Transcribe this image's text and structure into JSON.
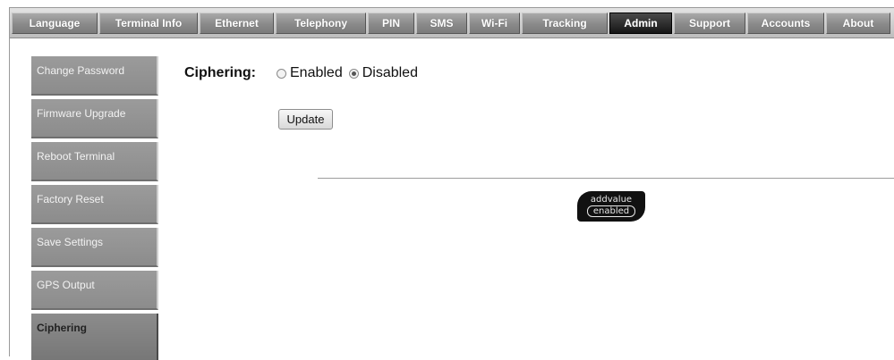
{
  "tabs": [
    {
      "label": "Language",
      "active": false
    },
    {
      "label": "Terminal Info",
      "active": false
    },
    {
      "label": "Ethernet",
      "active": false
    },
    {
      "label": "Telephony",
      "active": false
    },
    {
      "label": "PIN",
      "active": false
    },
    {
      "label": "SMS",
      "active": false
    },
    {
      "label": "Wi-Fi",
      "active": false
    },
    {
      "label": "Tracking",
      "active": false
    },
    {
      "label": "Admin",
      "active": true
    },
    {
      "label": "Support",
      "active": false
    },
    {
      "label": "Accounts",
      "active": false
    },
    {
      "label": "About",
      "active": false
    }
  ],
  "sidebar": {
    "items": [
      {
        "label": "Change Password"
      },
      {
        "label": "Firmware Upgrade"
      },
      {
        "label": "Reboot Terminal"
      },
      {
        "label": "Factory Reset"
      },
      {
        "label": "Save Settings"
      },
      {
        "label": "GPS Output"
      },
      {
        "label": "Ciphering",
        "active": true
      }
    ]
  },
  "ciphering": {
    "label": "Ciphering:",
    "options": [
      {
        "label": "Enabled",
        "checked": false
      },
      {
        "label": "Disabled",
        "checked": true
      }
    ],
    "update_label": "Update"
  },
  "logo": {
    "line1": "addvalue",
    "line2": "enabled"
  },
  "colors": {
    "active_tab": "#161616",
    "tab": "#8a8a8a",
    "sidebar": "#919191"
  }
}
